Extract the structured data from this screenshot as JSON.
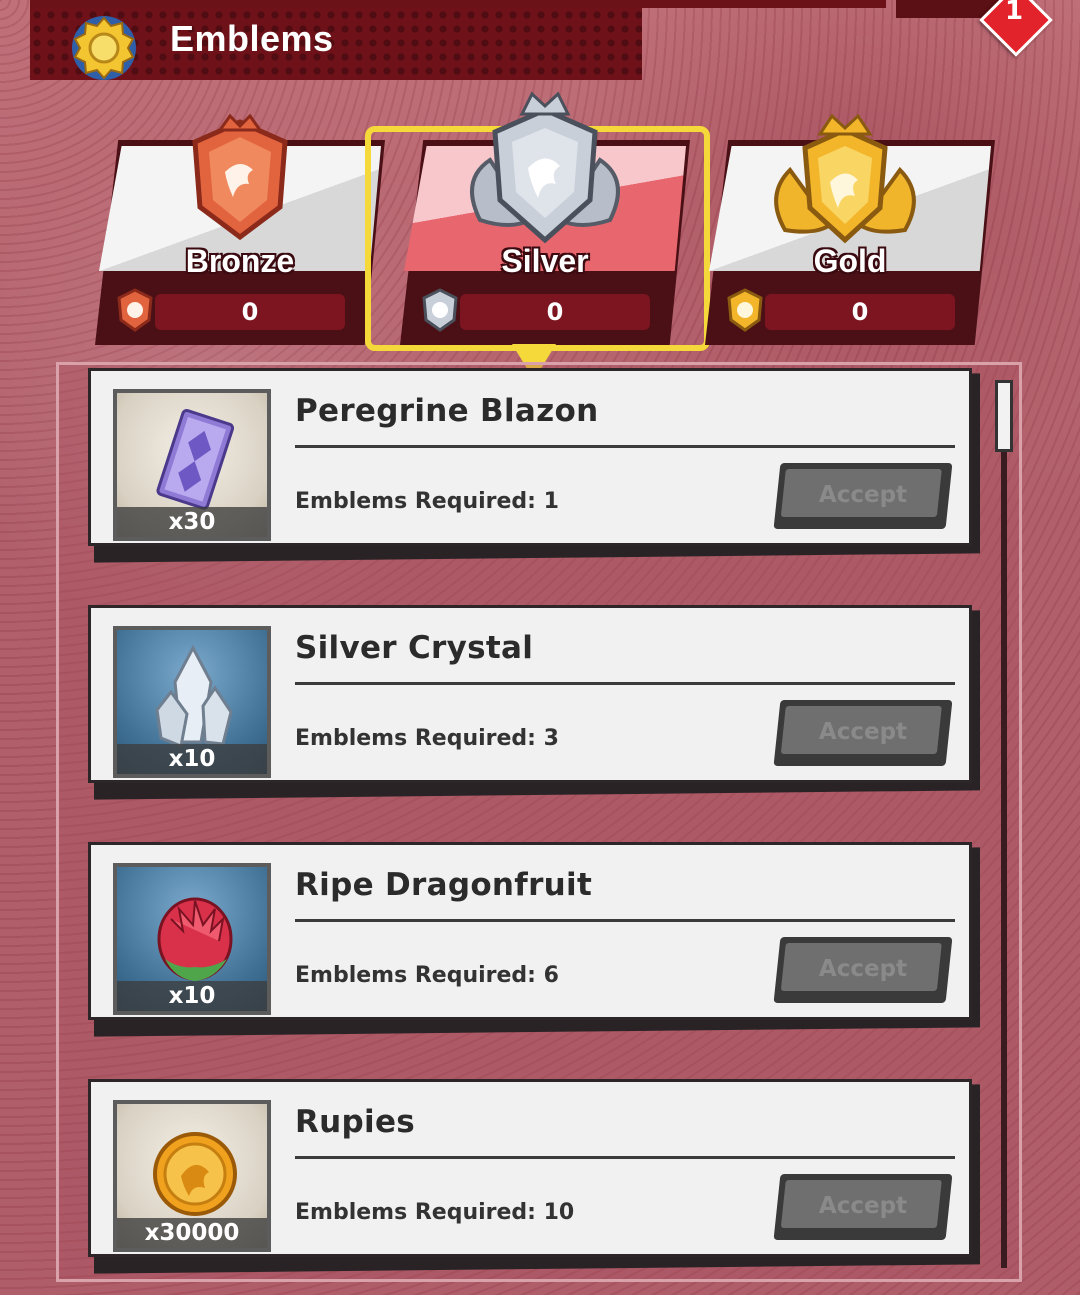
{
  "header": {
    "title": "Emblems",
    "notification_count": "1"
  },
  "tabs": [
    {
      "label": "Bronze",
      "count": "0",
      "selected": false,
      "color": "#d85a3a"
    },
    {
      "label": "Silver",
      "count": "0",
      "selected": true,
      "color": "#9aa3b2"
    },
    {
      "label": "Gold",
      "count": "0",
      "selected": false,
      "color": "#e9a826"
    }
  ],
  "rewards": [
    {
      "name": "Peregrine Blazon",
      "quantity": "x30",
      "requirement": "Emblems Required: 1",
      "button": "Accept",
      "icon": "blazon-card-icon"
    },
    {
      "name": "Silver Crystal",
      "quantity": "x10",
      "requirement": "Emblems Required: 3",
      "button": "Accept",
      "icon": "silver-crystal-icon"
    },
    {
      "name": "Ripe Dragonfruit",
      "quantity": "x10",
      "requirement": "Emblems Required: 6",
      "button": "Accept",
      "icon": "dragonfruit-icon"
    },
    {
      "name": "Rupies",
      "quantity": "x30000",
      "requirement": "Emblems Required: 10",
      "button": "Accept",
      "icon": "rupie-coin-icon"
    }
  ],
  "colors": {
    "accent_selected": "#f5d83a",
    "header_bg": "#6e1119",
    "button_disabled": "#6f6f6f"
  }
}
